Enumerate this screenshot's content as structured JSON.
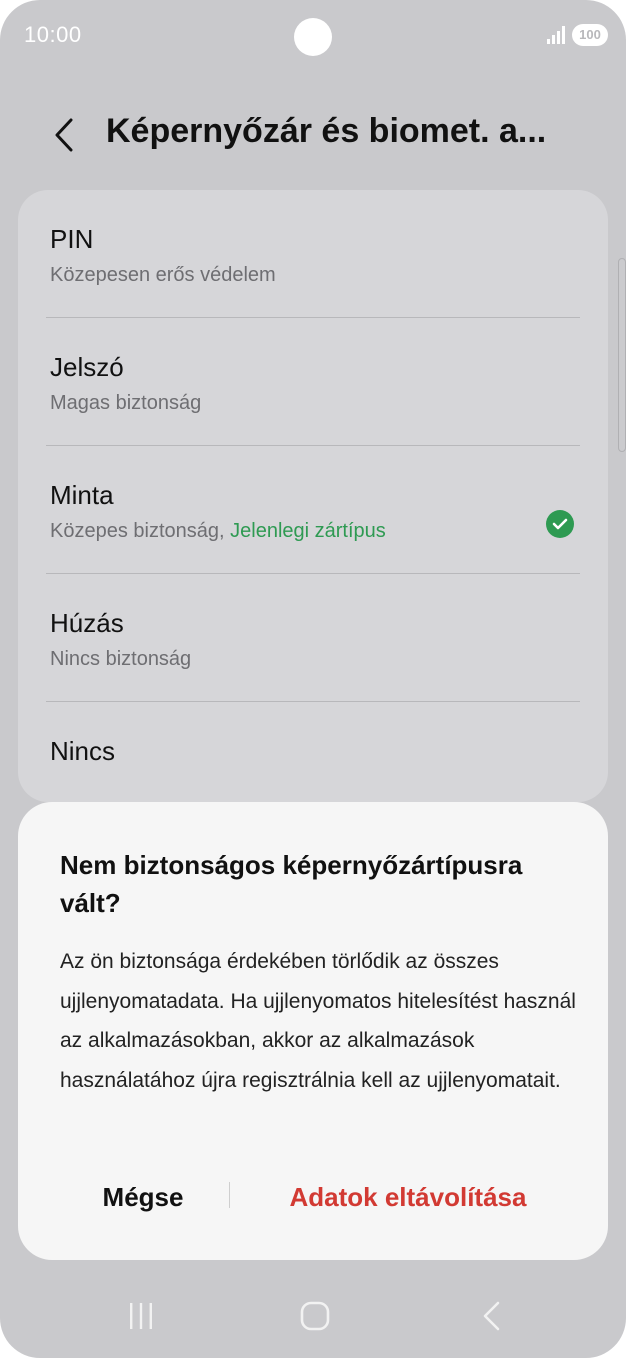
{
  "status_bar": {
    "time": "10:00",
    "battery": "100"
  },
  "header": {
    "title": "Képernyőzár és biomet. a..."
  },
  "options": [
    {
      "title": "PIN",
      "subtitle": "Közepesen erős védelem"
    },
    {
      "title": "Jelszó",
      "subtitle": "Magas biztonság"
    },
    {
      "title": "Minta",
      "subtitle": "Közepes biztonság, ",
      "current": "Jelenlegi zártípus"
    },
    {
      "title": "Húzás",
      "subtitle": "Nincs biztonság"
    },
    {
      "title": "Nincs"
    }
  ],
  "dialog": {
    "title": "Nem biztonságos képernyőzártípusra vált?",
    "body": "Az ön biztonsága érdekében törlődik az összes ujjlenyomatadata. Ha ujjlenyomatos hitelesítést használ az alkalmazásokban, akkor az alkalmazások használatához újra regisztrálnia kell az ujjlenyomatait.",
    "cancel_label": "Mégse",
    "confirm_label": "Adatok eltávolítása"
  },
  "colors": {
    "accent_green": "#2e9a52",
    "destructive_red": "#d23a33",
    "background": "#c9c9cc"
  },
  "icons": [
    "back-arrow-icon",
    "check-circle-icon",
    "signal-icon",
    "battery-icon",
    "recents-icon",
    "home-icon",
    "nav-back-icon"
  ]
}
